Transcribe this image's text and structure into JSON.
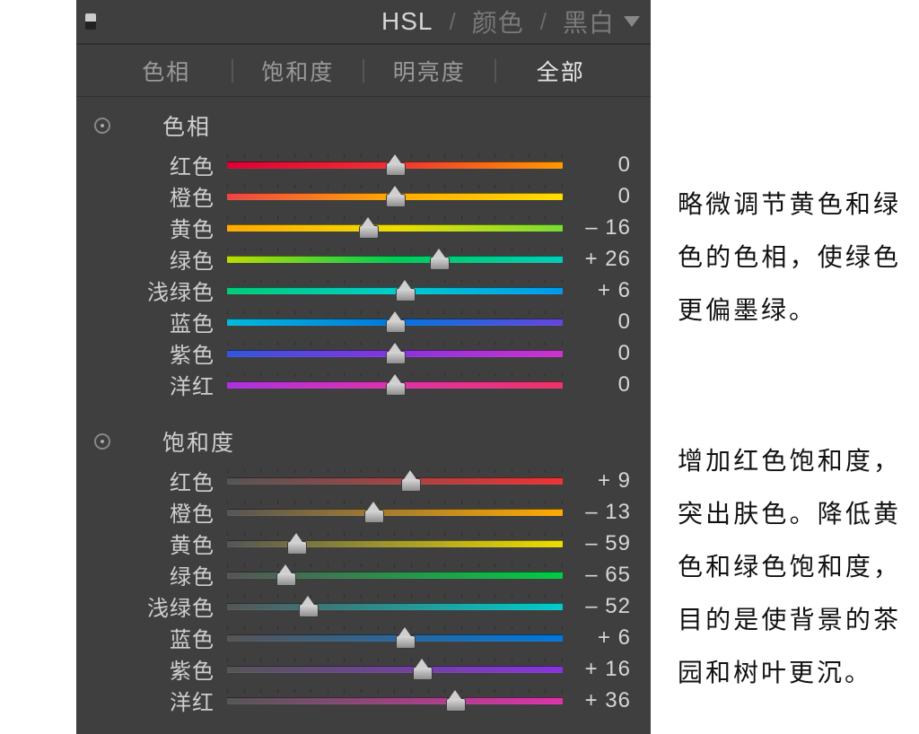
{
  "header": {
    "modes": [
      "HSL",
      "颜色",
      "黑白"
    ],
    "active_mode_index": 0
  },
  "tabs": {
    "items": [
      "色相",
      "饱和度",
      "明亮度",
      "全部"
    ],
    "active_index": 3
  },
  "colors": {
    "red": "红色",
    "orange": "橙色",
    "yellow": "黄色",
    "green": "绿色",
    "aqua": "浅绿色",
    "blue": "蓝色",
    "purple": "紫色",
    "magenta": "洋红"
  },
  "sections": [
    {
      "title": "色相",
      "kind": "hue",
      "rows": [
        {
          "key": "red",
          "value": 0
        },
        {
          "key": "orange",
          "value": 0
        },
        {
          "key": "yellow",
          "value": -16
        },
        {
          "key": "green",
          "value": 26
        },
        {
          "key": "aqua",
          "value": 6
        },
        {
          "key": "blue",
          "value": 0
        },
        {
          "key": "purple",
          "value": 0
        },
        {
          "key": "magenta",
          "value": 0
        }
      ]
    },
    {
      "title": "饱和度",
      "kind": "sat",
      "rows": [
        {
          "key": "red",
          "value": 9
        },
        {
          "key": "orange",
          "value": -13
        },
        {
          "key": "yellow",
          "value": -59
        },
        {
          "key": "green",
          "value": -65
        },
        {
          "key": "aqua",
          "value": -52
        },
        {
          "key": "blue",
          "value": 6
        },
        {
          "key": "purple",
          "value": 16
        },
        {
          "key": "magenta",
          "value": 36
        }
      ]
    }
  ],
  "notes": [
    "略微调节黄色和绿色的色相，使绿色更偏墨绿。",
    "增加红色饱和度，突出肤色。降低黄色和绿色饱和度，目的是使背景的茶园和树叶更沉。"
  ]
}
